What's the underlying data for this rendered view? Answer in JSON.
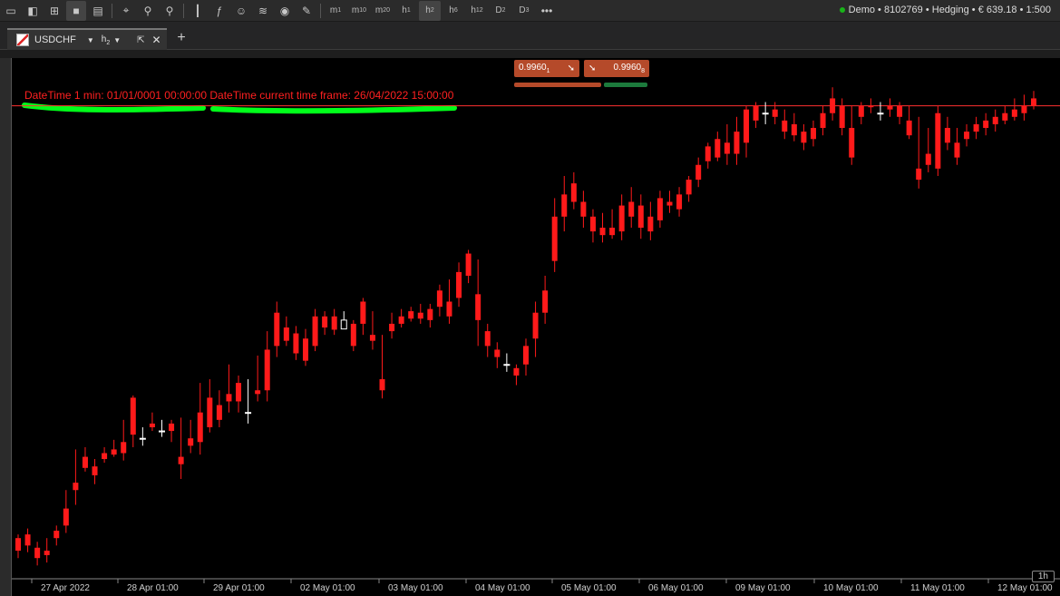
{
  "toolbar": {
    "timeframes": [
      {
        "id": "m1",
        "base": "m",
        "sub": "1"
      },
      {
        "id": "m10",
        "base": "m",
        "sub": "10"
      },
      {
        "id": "m20",
        "base": "m",
        "sub": "20"
      },
      {
        "id": "h1",
        "base": "h",
        "sub": "1"
      },
      {
        "id": "h2",
        "base": "h",
        "sub": "2",
        "active": true
      },
      {
        "id": "h6",
        "base": "h",
        "sub": "6"
      },
      {
        "id": "h12",
        "base": "h",
        "sub": "12"
      },
      {
        "id": "D2",
        "base": "D",
        "sub": "2"
      },
      {
        "id": "D3",
        "base": "D",
        "sub": "3"
      }
    ],
    "more": "•••"
  },
  "account": {
    "status_color": "#19b319",
    "text": "Demo • 8102769 • Hedging • € 639.18 • 1:500"
  },
  "tab": {
    "symbol": "USDCHF",
    "timeframe_base": "h",
    "timeframe_sub": "2",
    "add": "+"
  },
  "trade": {
    "sell_price": "0.9960",
    "sell_sup": "1",
    "buy_price": "0.9960",
    "buy_sup": "8",
    "sell_color": "#b54a2a",
    "buy_color": "#b54a2a",
    "bar_sell_color": "#b54a2a",
    "bar_buy_color": "#1c7a3c"
  },
  "overlay": {
    "text": "DateTime 1 min: 01/01/0001 00:00:00 DateTime current time frame: 26/04/2022 15:00:00",
    "color": "#ff2020",
    "highlight_color": "#00ff1a"
  },
  "chart": {
    "timeframe_badge": "1h",
    "price_line_color": "#ff3030",
    "up_color": "#ffffff",
    "down_color": "#ff1a1a"
  },
  "chart_data": {
    "type": "candlestick",
    "symbol": "USDCHF",
    "x_labels": [
      "27 Apr 2022",
      "28 Apr 01:00",
      "29 Apr 01:00",
      "02 May 01:00",
      "03 May 01:00",
      "04 May 01:00",
      "05 May 01:00",
      "06 May 01:00",
      "09 May 01:00",
      "10 May 01:00",
      "11 May 01:00",
      "12 May 01:00"
    ],
    "candles": [
      [
        55,
        60,
        38,
        28
      ],
      [
        60,
        68,
        45,
        36
      ],
      [
        42,
        50,
        28,
        18
      ],
      [
        38,
        55,
        32,
        22
      ],
      [
        65,
        72,
        55,
        45
      ],
      [
        95,
        120,
        72,
        62
      ],
      [
        130,
        175,
        120,
        100
      ],
      [
        165,
        178,
        150,
        145
      ],
      [
        152,
        162,
        140,
        128
      ],
      [
        170,
        178,
        162,
        157
      ],
      [
        175,
        188,
        168,
        165
      ],
      [
        185,
        215,
        170,
        160
      ],
      [
        245,
        248,
        195,
        178
      ],
      [
        190,
        205,
        190,
        180
      ],
      [
        210,
        225,
        205,
        200
      ],
      [
        200,
        215,
        200,
        192
      ],
      [
        210,
        215,
        200,
        185
      ],
      [
        165,
        218,
        155,
        135
      ],
      [
        190,
        215,
        180,
        170
      ],
      [
        225,
        265,
        185,
        168
      ],
      [
        245,
        270,
        205,
        198
      ],
      [
        235,
        255,
        215,
        205
      ],
      [
        250,
        290,
        240,
        225
      ],
      [
        265,
        275,
        240,
        225
      ],
      [
        225,
        270,
        225,
        210
      ],
      [
        255,
        302,
        250,
        240
      ],
      [
        310,
        335,
        255,
        240
      ],
      [
        360,
        375,
        315,
        300
      ],
      [
        340,
        355,
        322,
        315
      ],
      [
        332,
        342,
        305,
        296
      ],
      [
        325,
        338,
        295,
        288
      ],
      [
        355,
        365,
        315,
        308
      ],
      [
        355,
        362,
        340,
        330
      ],
      [
        355,
        365,
        337,
        330
      ],
      [
        338,
        362,
        350,
        345
      ],
      [
        345,
        350,
        315,
        308
      ],
      [
        375,
        380,
        345,
        330
      ],
      [
        330,
        362,
        322,
        310
      ],
      [
        270,
        330,
        255,
        244
      ],
      [
        345,
        360,
        335,
        325
      ],
      [
        355,
        365,
        345,
        340
      ],
      [
        362,
        368,
        352,
        348
      ],
      [
        360,
        372,
        352,
        345
      ],
      [
        365,
        372,
        350,
        340
      ],
      [
        390,
        398,
        368,
        355
      ],
      [
        375,
        405,
        355,
        345
      ],
      [
        415,
        428,
        380,
        368
      ],
      [
        440,
        445,
        410,
        400
      ],
      [
        385,
        432,
        350,
        315
      ],
      [
        335,
        345,
        315,
        300
      ],
      [
        310,
        320,
        300,
        285
      ],
      [
        290,
        305,
        290,
        280
      ],
      [
        285,
        290,
        275,
        262
      ],
      [
        315,
        325,
        290,
        275
      ],
      [
        360,
        375,
        325,
        300
      ],
      [
        390,
        410,
        360,
        345
      ],
      [
        490,
        515,
        430,
        415
      ],
      [
        520,
        545,
        490,
        470
      ],
      [
        535,
        550,
        510,
        500
      ],
      [
        510,
        525,
        490,
        475
      ],
      [
        490,
        500,
        470,
        455
      ],
      [
        475,
        495,
        465,
        455
      ],
      [
        475,
        500,
        465,
        460
      ],
      [
        505,
        520,
        470,
        458
      ],
      [
        510,
        530,
        490,
        475
      ],
      [
        505,
        520,
        475,
        460
      ],
      [
        490,
        510,
        470,
        458
      ],
      [
        515,
        525,
        485,
        475
      ],
      [
        510,
        525,
        505,
        495
      ],
      [
        520,
        530,
        500,
        490
      ],
      [
        540,
        545,
        520,
        510
      ],
      [
        560,
        570,
        540,
        530
      ],
      [
        585,
        590,
        565,
        555
      ],
      [
        595,
        605,
        570,
        565
      ],
      [
        590,
        615,
        575,
        560
      ],
      [
        605,
        625,
        575,
        560
      ],
      [
        635,
        640,
        590,
        570
      ],
      [
        640,
        645,
        620,
        610
      ],
      [
        630,
        645,
        630,
        615
      ],
      [
        635,
        645,
        625,
        615
      ],
      [
        620,
        635,
        605,
        595
      ],
      [
        615,
        630,
        600,
        592
      ],
      [
        605,
        615,
        590,
        580
      ],
      [
        610,
        620,
        595,
        585
      ],
      [
        630,
        640,
        610,
        600
      ],
      [
        650,
        665,
        630,
        620
      ],
      [
        640,
        650,
        610,
        600
      ],
      [
        610,
        640,
        570,
        560
      ],
      [
        640,
        645,
        625,
        615
      ],
      [
        640,
        650,
        638,
        630
      ],
      [
        630,
        645,
        630,
        620
      ],
      [
        640,
        650,
        635,
        625
      ],
      [
        640,
        645,
        625,
        615
      ],
      [
        620,
        640,
        600,
        595
      ],
      [
        555,
        625,
        540,
        528
      ],
      [
        575,
        610,
        560,
        550
      ],
      [
        630,
        640,
        555,
        545
      ],
      [
        610,
        625,
        590,
        580
      ],
      [
        590,
        610,
        570,
        560
      ],
      [
        605,
        615,
        595,
        585
      ],
      [
        615,
        625,
        605,
        595
      ],
      [
        620,
        630,
        610,
        600
      ],
      [
        625,
        635,
        615,
        605
      ],
      [
        630,
        640,
        620,
        615
      ],
      [
        635,
        650,
        625,
        620
      ],
      [
        640,
        655,
        630,
        620
      ],
      [
        650,
        660,
        640,
        635
      ]
    ],
    "candle_format": [
      "open",
      "high",
      "close",
      "low"
    ],
    "price_line": 640,
    "ylim": [
      0,
      680
    ]
  }
}
